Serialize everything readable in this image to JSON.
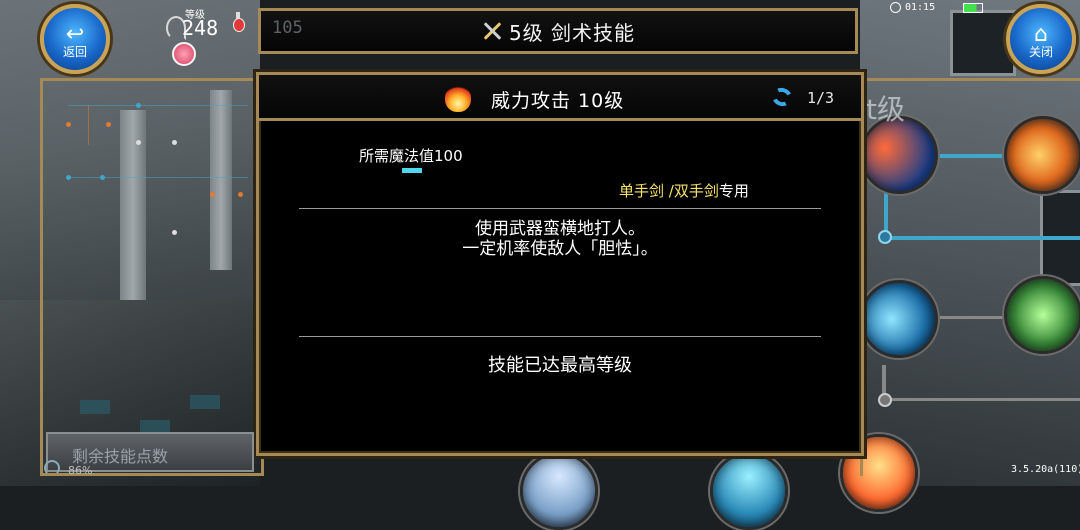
{
  "header": {
    "title": "5级 剑术技能",
    "back_label": "返回",
    "close_label": "关闭",
    "level_label": "等级",
    "level_value": "248",
    "ghost_number": "105"
  },
  "status_bar": {
    "time": "01:15",
    "battery_percent": "86%"
  },
  "dialog": {
    "skill_name": "威力攻击 10级",
    "page_indicator": "1/3",
    "mp_cost": "所需魔法值100",
    "weapon_types": "单手剑 /双手剑",
    "weapon_suffix": "专用",
    "description_line1": "使用武器蛮横地打人。",
    "description_line2": "一定机率使敌人「胆怯」。",
    "max_level_text": "技能已达最高等级"
  },
  "footer": {
    "skill_points_label": "剩余技能点数",
    "version": "3.5.20a(110)"
  },
  "background": {
    "partial_label": "t级"
  },
  "icons": {
    "back": "back-arrow-icon",
    "close": "home-icon",
    "title": "crossed-swords-icon",
    "skill": "flame-icon",
    "cycle": "cycle-arrows-icon"
  },
  "colors": {
    "frame_gold": "#a68a55",
    "button_blue": "#1867c8",
    "weapon_text": "#f6e26a",
    "mp_bar": "#4fd8f0"
  }
}
